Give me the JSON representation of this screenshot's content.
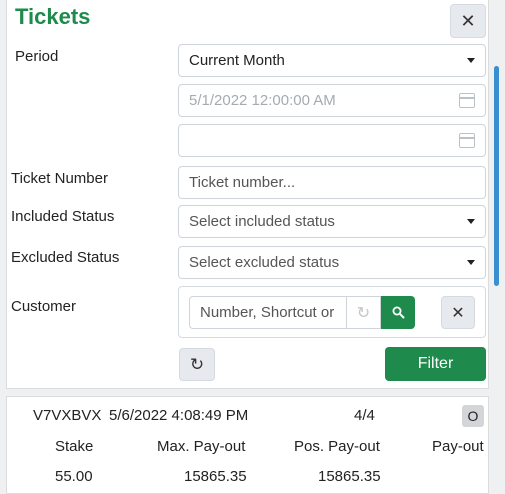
{
  "header": {
    "title": "Tickets",
    "close_symbol": "✕"
  },
  "form": {
    "period_label": "Period",
    "period_value": "Current Month",
    "date_from_placeholder": "5/1/2022 12:00:00 AM",
    "date_to_placeholder": "",
    "ticket_number_label": "Ticket Number",
    "ticket_number_placeholder": "Ticket number...",
    "included_status_label": "Included Status",
    "included_status_placeholder": "Select included status",
    "excluded_status_label": "Excluded Status",
    "excluded_status_placeholder": "Select excluded status",
    "customer_label": "Customer",
    "customer_placeholder": "Number, Shortcut or",
    "filter_label": "Filter"
  },
  "ticket": {
    "code": "V7VXBVX",
    "date": "5/6/2022 4:08:49 PM",
    "count": "4/4",
    "status": "O",
    "columns": [
      "Stake",
      "Max. Pay-out",
      "Pos. Pay-out",
      "Pay-out"
    ],
    "values": [
      "55.00",
      "15865.35",
      "15865.35",
      ""
    ]
  },
  "colors": {
    "accent": "#1e8a4c",
    "scrollbar": "#3a8fd0"
  },
  "icons": [
    "close-icon",
    "calendar-icon",
    "caret-down-icon",
    "refresh-icon",
    "search-icon"
  ]
}
